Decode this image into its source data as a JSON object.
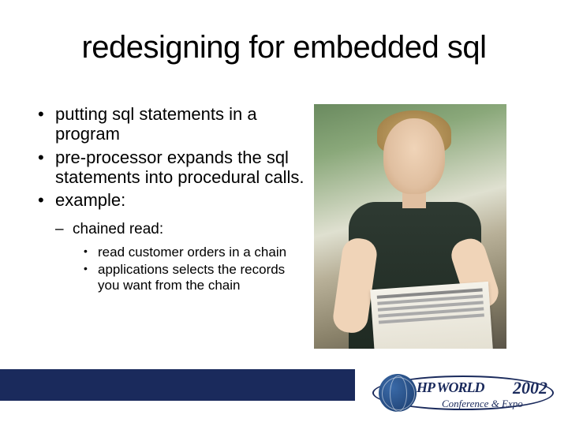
{
  "title": "redesigning for embedded sql",
  "bullets": {
    "b1": "putting sql statements in a program",
    "b2": "pre-processor expands the sql statements into procedural calls.",
    "b3": "example:",
    "sub1": "chained read:",
    "ss1": "read customer orders in a chain",
    "ss2": "applications selects the records you want from the chain"
  },
  "image": {
    "alt": "photo of a young man with blond hair in a dark t-shirt holding a newspaper, arms crossed"
  },
  "logo": {
    "brand_prefix": "HP",
    "brand_word": "WORLD",
    "year": "2002",
    "subtitle": "Conference & Expo"
  }
}
